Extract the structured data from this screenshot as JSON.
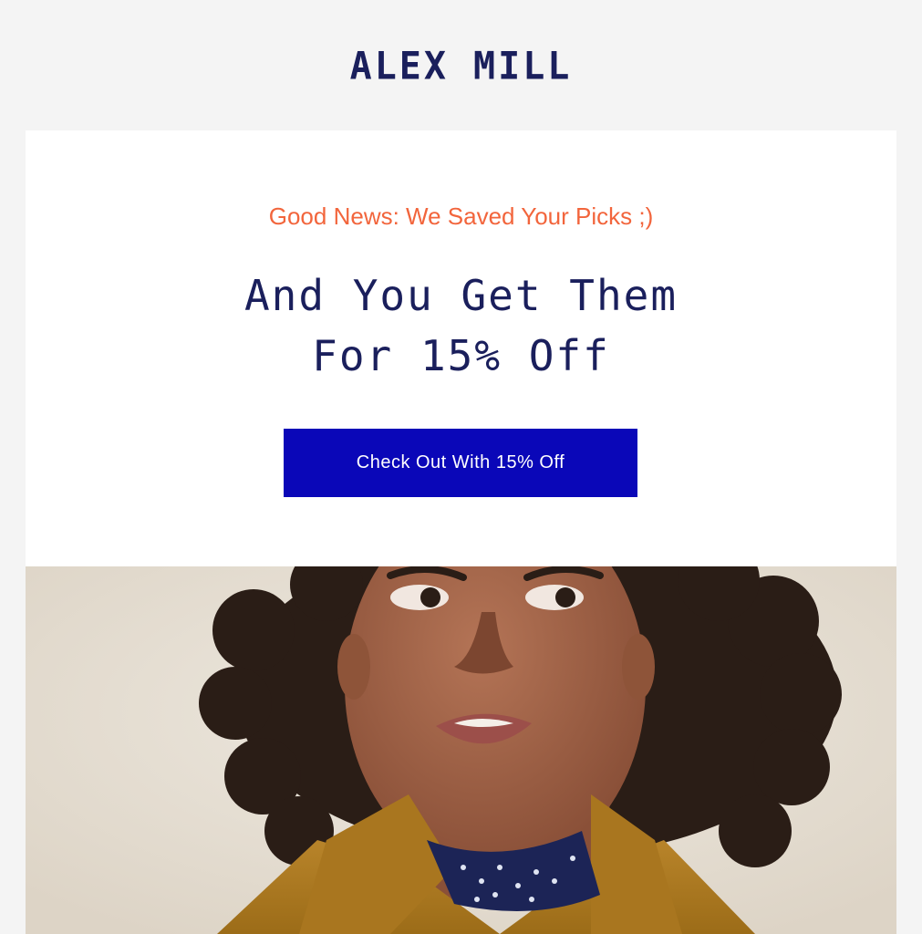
{
  "brand": {
    "logo_text": "ALEX MILL"
  },
  "promo": {
    "eyebrow": "Good News: We Saved Your Picks ;)",
    "headline_line1": "And You Get Them",
    "headline_line2": "For 15% Off",
    "cta_label": "Check Out With 15% Off"
  },
  "colors": {
    "background": "#f4f4f4",
    "card": "#ffffff",
    "navy": "#1a1f5c",
    "accent_orange": "#f2653c",
    "cta_blue": "#0a07b8",
    "jacket_mustard": "#b07c1e"
  }
}
